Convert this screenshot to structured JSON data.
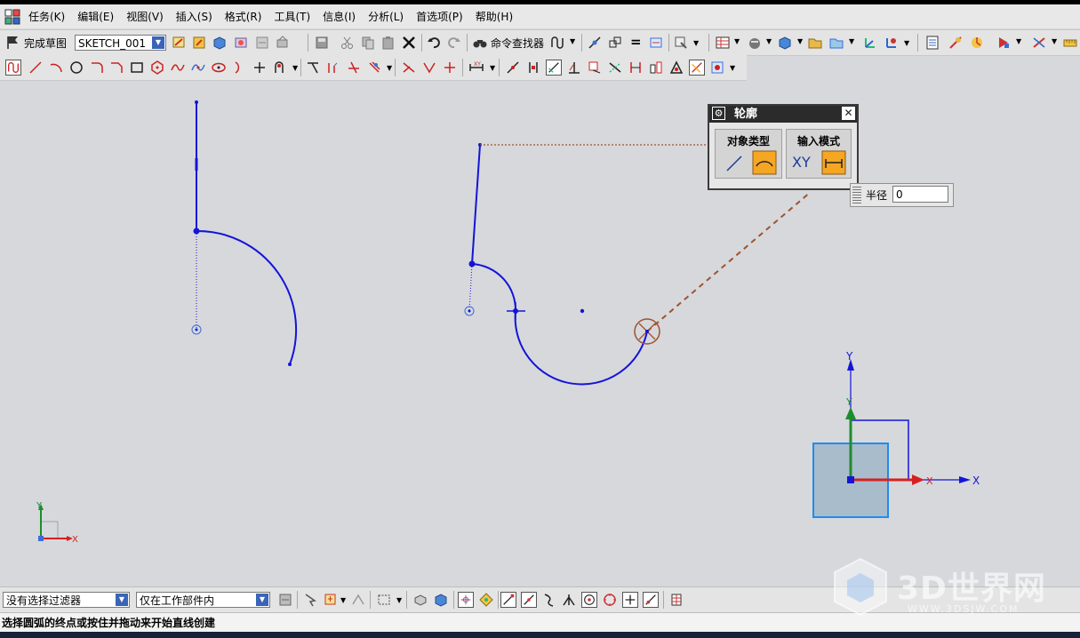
{
  "menu": [
    "任务(K)",
    "编辑(E)",
    "视图(V)",
    "插入(S)",
    "格式(R)",
    "工具(T)",
    "信息(I)",
    "分析(L)",
    "首选项(P)",
    "帮助(H)"
  ],
  "toolbar": {
    "finish_sketch_label": "完成草图",
    "sketch_name": "SKETCH_001",
    "command_finder_label": "命令查找器"
  },
  "profile_dialog": {
    "title": "轮廓",
    "object_type_label": "对象类型",
    "input_mode_label": "输入模式",
    "xy_label": "XY"
  },
  "radius": {
    "label": "半径",
    "value": "0"
  },
  "axes": {
    "x_label": "X",
    "y_label": "Y"
  },
  "bottom_toolbar": {
    "filter_value": "没有选择过滤器",
    "scope_value": "仅在工作部件内"
  },
  "status_text": "选择圆弧的终点或按住并拖动来开始直线创建",
  "watermark": {
    "title": "3D世界网",
    "url": "WWW.3DSJW.COM"
  },
  "colors": {
    "sketch_curve": "#1414d8",
    "canvas_bg": "#d6d8dc",
    "accent": "#f5a623",
    "x_axis": "#d62020",
    "y_axis": "#1e8c2c"
  }
}
